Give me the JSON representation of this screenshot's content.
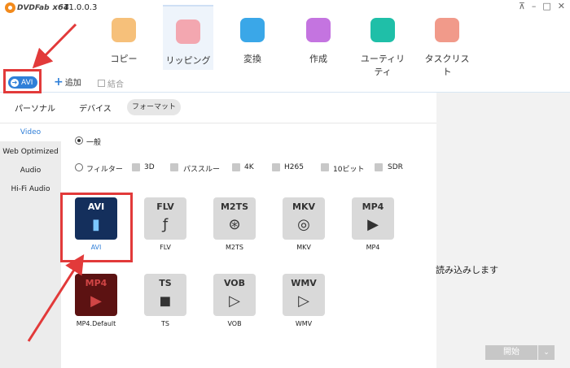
{
  "app": {
    "logo_text": "DVDFab",
    "arch": "x64",
    "version": "11.0.0.3"
  },
  "window_controls": [
    "pin-icon",
    "minimize-icon",
    "maximize-icon",
    "close-icon"
  ],
  "toolbar": {
    "tools": [
      {
        "label": "コピー",
        "icon": "copy-disc-icon",
        "color": "#f6c07a"
      },
      {
        "label": "リッピング",
        "icon": "ripper-disc-icon",
        "color": "#f3a7b0"
      },
      {
        "label": "変換",
        "icon": "converter-film-icon",
        "color": "#3aa7e8"
      },
      {
        "label": "作成",
        "icon": "creator-icon",
        "color": "#c474e0"
      },
      {
        "label": "ユーティリティ",
        "icon": "utility-icon",
        "color": "#1fbfa8"
      },
      {
        "label": "タスクリスト",
        "icon": "tasklist-icon",
        "color": "#f19a8a"
      }
    ],
    "active_index": 1
  },
  "subbar": {
    "profile_label": "AVI",
    "add_label": "追加",
    "merge_label": "結合"
  },
  "tabs": {
    "personal": "パーソナル",
    "device": "デバイス",
    "format": "フォーマット"
  },
  "sidenav": [
    "Video",
    "Web Optimized",
    "Audio",
    "Hi-Fi Audio"
  ],
  "options": {
    "general": "一般",
    "filter": "フィルター",
    "checks": [
      "3D",
      "パススルー",
      "4K",
      "H265",
      "10ビット",
      "SDR"
    ]
  },
  "formats": [
    {
      "abbr": "AVI",
      "name": "AVI",
      "glyph": "film-strip-icon",
      "symbol": "▮"
    },
    {
      "abbr": "FLV",
      "name": "FLV",
      "glyph": "flash-icon",
      "symbol": "ƒ"
    },
    {
      "abbr": "M2TS",
      "name": "M2TS",
      "glyph": "film-reel-icon",
      "symbol": "⊛"
    },
    {
      "abbr": "MKV",
      "name": "MKV",
      "glyph": "matroska-icon",
      "symbol": "◎"
    },
    {
      "abbr": "MP4",
      "name": "MP4",
      "glyph": "play-clapper-icon",
      "symbol": "▶"
    },
    {
      "abbr": "MP4",
      "name": "MP4.Default",
      "glyph": "play-clapper-icon",
      "symbol": "▶"
    },
    {
      "abbr": "TS",
      "name": "TS",
      "glyph": "camera-icon",
      "symbol": "◼"
    },
    {
      "abbr": "VOB",
      "name": "VOB",
      "glyph": "play-circle-icon",
      "symbol": "▷"
    },
    {
      "abbr": "WMV",
      "name": "WMV",
      "glyph": "play-circle-icon",
      "symbol": "▷"
    }
  ],
  "right_panel": {
    "message": "読み込みします"
  },
  "bottom": {
    "start_label": "開始",
    "dropdown_symbol": "⌄"
  },
  "colors": {
    "accent": "#2f7fd8",
    "annotation": "#e23a3a"
  }
}
